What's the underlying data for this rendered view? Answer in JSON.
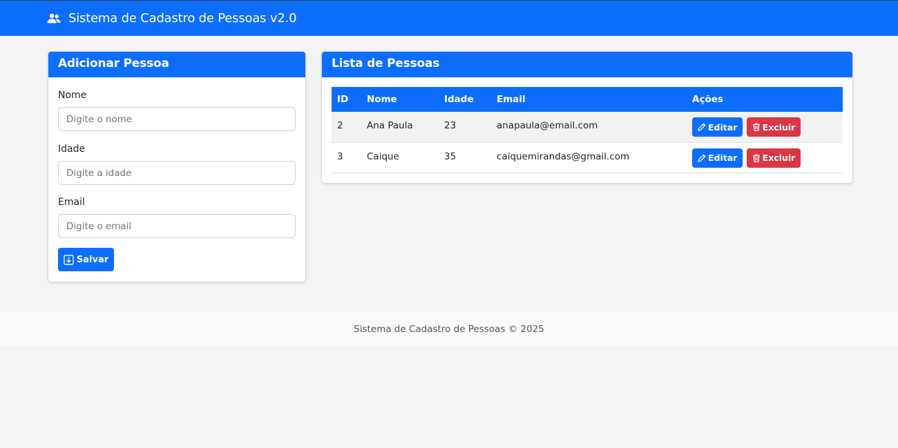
{
  "navbar": {
    "icon": "users-icon",
    "title": "Sistema de Cadastro de Pessoas v2.0"
  },
  "form": {
    "title": "Adicionar Pessoa",
    "fields": [
      {
        "label": "Nome",
        "placeholder": "Digite o nome",
        "value": ""
      },
      {
        "label": "Idade",
        "placeholder": "Digite a idade",
        "value": ""
      },
      {
        "label": "Email",
        "placeholder": "Digite o email",
        "value": ""
      }
    ],
    "save_label": "Salvar",
    "save_icon": "download-icon"
  },
  "list": {
    "title": "Lista de Pessoas",
    "columns": [
      "ID",
      "Nome",
      "Idade",
      "Email",
      "Ações"
    ],
    "rows": [
      {
        "id": "2",
        "nome": "Ana Paula",
        "idade": "23",
        "email": "anapaula@email.com",
        "edit_label": "Editar",
        "delete_label": "Excluir"
      },
      {
        "id": "3",
        "nome": "Caique",
        "idade": "35",
        "email": "caiquemirandas@gmail.com",
        "edit_label": "Editar",
        "delete_label": "Excluir"
      }
    ]
  },
  "footer": {
    "text": "Sistema de Cadastro de Pessoas © 2025"
  },
  "colors": {
    "primary": "#0d6efd",
    "danger": "#dc3545",
    "background": "#f4f4f4"
  }
}
